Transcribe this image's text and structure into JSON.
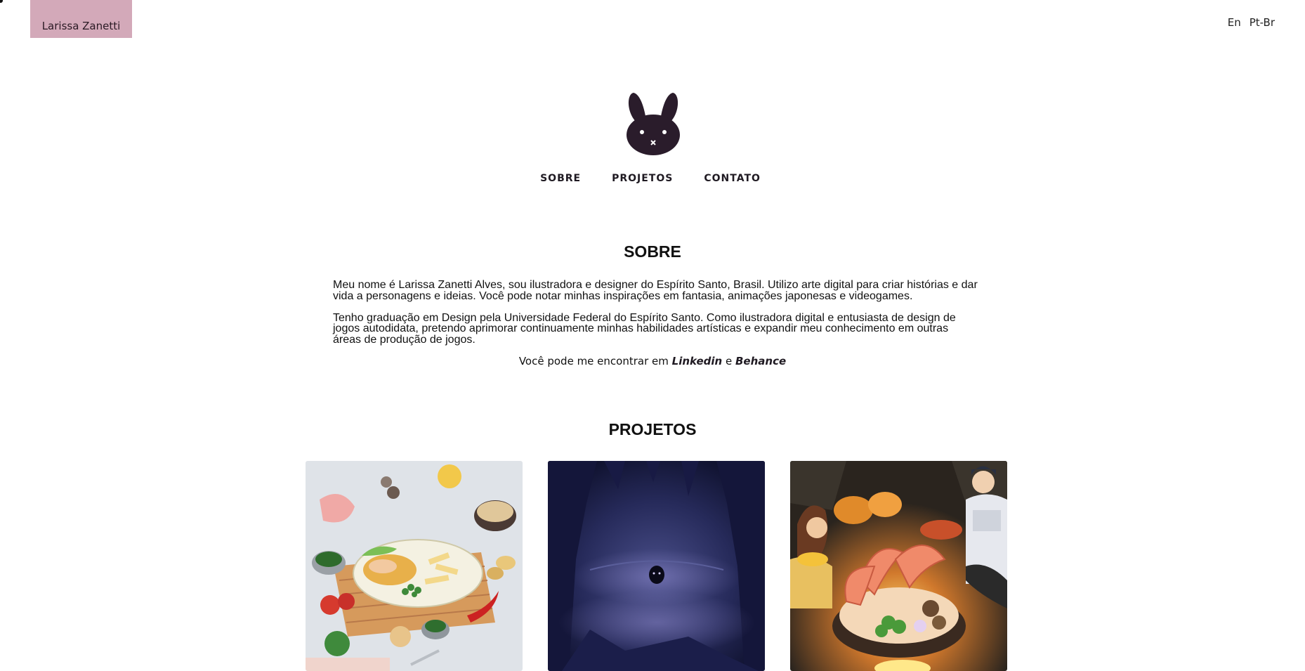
{
  "header": {
    "name_tag": "Larissa Zanetti",
    "languages": [
      "En",
      "Pt-Br"
    ]
  },
  "logo": {
    "icon": "bunny-icon"
  },
  "nav": {
    "items": [
      "SOBRE",
      "PROJETOS",
      "CONTATO"
    ]
  },
  "about": {
    "title": "SOBRE",
    "paragraph_1": "Meu nome é Larissa Zanetti Alves, sou ilustradora e designer do Espírito Santo, Brasil. Utilizo arte digital para criar histórias e dar vida a personagens e ideias. Você pode notar minhas inspirações em fantasia, animações japonesas e videogames.",
    "paragraph_2": "Tenho graduação em Design pela Universidade Federal do Espírito Santo. Como ilustradora digital e entusiasta de design de jogos autodidata, pretendo aprimorar continuamente minhas habilidades artísticas e expandir meu conhecimento em outras áreas de produção de jogos.",
    "find_prefix": "Você pode me encontrar em",
    "link_linkedin": "Linkedin",
    "find_and": "e",
    "link_behance": "Behance"
  },
  "projects": {
    "title": "PROJETOS"
  },
  "colors": {
    "name_tag_bg": "#d3a9b9",
    "logo": "#2a1c2b"
  }
}
